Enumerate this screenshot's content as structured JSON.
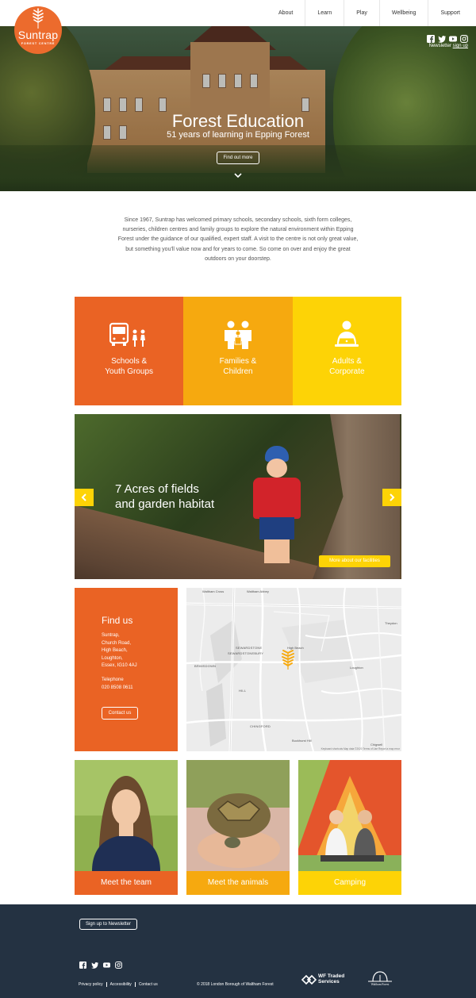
{
  "header": {
    "logo_name": "Suntrap",
    "logo_sub": "FOREST CENTRE",
    "nav": [
      "About",
      "Learn",
      "Play",
      "Wellbeing",
      "Support"
    ]
  },
  "social_top": {
    "icons": [
      "facebook-icon",
      "twitter-icon",
      "youtube-icon",
      "instagram-icon"
    ],
    "newsletter_text": "Newsletter",
    "newsletter_link": "sign up"
  },
  "hero": {
    "title": "Forest Education",
    "tagline": "51 years of learning in Epping Forest",
    "button": "Find out more"
  },
  "intro": {
    "text": "Since 1967, Suntrap has welcomed primary schools, secondary schools, sixth form colleges, nurseries, children centres and family groups to explore the natural environment within Epping Forest under the guidance of our qualified, expert staff. A visit to the centre is not only great value, but something you'll value now and for years to come. So come on over and enjoy the great outdoors on your doorstep."
  },
  "tiles": [
    {
      "line1": "Schools &",
      "line2": "Youth Groups",
      "icon": "school-bus-icon",
      "color": "#ea6324"
    },
    {
      "line1": "Families &",
      "line2": "Children",
      "icon": "family-icon",
      "color": "#f6a90f"
    },
    {
      "line1": "Adults &",
      "line2": "Corporate",
      "icon": "adult-laptop-icon",
      "color": "#fdd306"
    }
  ],
  "slider": {
    "caption_line1": "7 Acres of fields",
    "caption_line2": "and garden habitat",
    "button": "More about our facilities"
  },
  "findus": {
    "title": "Find us",
    "address": [
      "Suntrap,",
      "Church Road,",
      "High Beach,",
      "Loughton,",
      "Essex, IG10 4AJ"
    ],
    "phone_label": "Telephone",
    "phone": "020 8508 0611",
    "button": "Contact us"
  },
  "map": {
    "labels": [
      "Waltham Cross",
      "Waltham Abbey",
      "Theydon",
      "SEWARDSTONE",
      "SEWARDSTONEBURY",
      "High Beach",
      "BRIMSDOWN",
      "Loughton",
      "HILL",
      "CHINGFORD",
      "Buckhurst Hill",
      "Chigwell"
    ],
    "attribution": "Keyboard shortcuts   Map data ©2020   Terms of Use   Report a map error"
  },
  "cards": [
    {
      "label": "Meet the team",
      "color": "#ea6324"
    },
    {
      "label": "Meet the animals",
      "color": "#f6a90f"
    },
    {
      "label": "Camping",
      "color": "#fdd306"
    }
  ],
  "footer": {
    "newsletter_button": "Sign up to Newsletter",
    "links": [
      "Privacy policy",
      "Accessibility",
      "Contact us"
    ],
    "copyright": "© 2018 London Borough of Waltham Forest",
    "partner1_line1": "WF Traded",
    "partner1_line2": "Services",
    "partner2": "Waltham Forest"
  }
}
